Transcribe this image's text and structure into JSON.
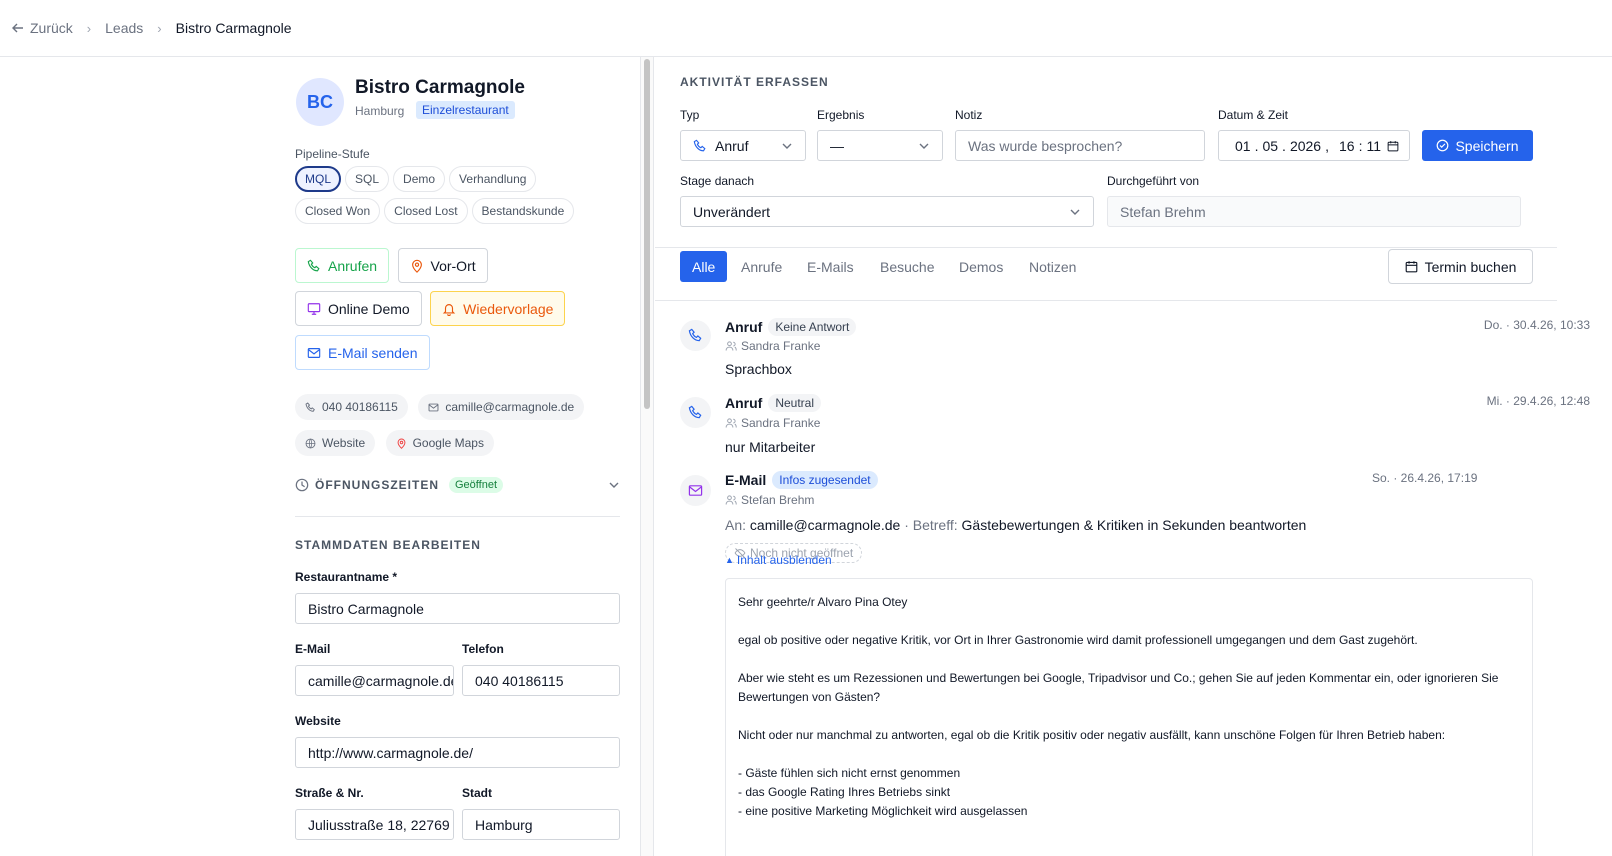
{
  "breadcrumb": {
    "back": "Zurück",
    "leads": "Leads",
    "current": "Bistro Carmagnole"
  },
  "lead": {
    "initials": "BC",
    "name": "Bistro Carmagnole",
    "city": "Hamburg",
    "type_badge": "Einzelrestaurant"
  },
  "pipeline": {
    "label": "Pipeline-Stufe",
    "stages": [
      "MQL",
      "SQL",
      "Demo",
      "Verhandlung",
      "Closed Won",
      "Closed Lost",
      "Bestandskunde"
    ],
    "active": "MQL"
  },
  "actions": {
    "call": "Anrufen",
    "onsite": "Vor-Ort",
    "demo": "Online Demo",
    "followup": "Wiedervorlage",
    "email": "E-Mail senden"
  },
  "contacts": {
    "phone": "040 40186115",
    "email": "camille@carmagnole.de",
    "website": "Website",
    "maps": "Google Maps"
  },
  "hours": {
    "title": "ÖFFNUNGSZEITEN",
    "status": "Geöffnet"
  },
  "master": {
    "title": "STAMMDATEN BEARBEITEN",
    "name_label": "Restaurantname *",
    "name_value": "Bistro Carmagnole",
    "email_label": "E-Mail",
    "email_value": "camille@carmagnole.de",
    "phone_label": "Telefon",
    "phone_value": "040 40186115",
    "website_label": "Website",
    "website_value": "http://www.carmagnole.de/",
    "street_label": "Straße & Nr.",
    "street_value": "Juliusstraße 18, 22769",
    "city_label": "Stadt",
    "city_value": "Hamburg"
  },
  "activity": {
    "title": "AKTIVITÄT ERFASSEN",
    "type_label": "Typ",
    "type_value": "Anruf",
    "result_label": "Ergebnis",
    "result_value": "—",
    "note_label": "Notiz",
    "note_placeholder": "Was wurde besprochen?",
    "datetime_label": "Datum & Zeit",
    "date_day": "01",
    "date_month": "05",
    "date_year": "2026",
    "time_hour": "16",
    "time_minute": "11",
    "save": "Speichern",
    "stage_label": "Stage danach",
    "stage_value": "Unverändert",
    "by_label": "Durchgeführt von",
    "by_value": "Stefan Brehm"
  },
  "tabs": [
    "Alle",
    "Anrufe",
    "E-Mails",
    "Besuche",
    "Demos",
    "Notizen"
  ],
  "book": "Termin buchen",
  "entries": [
    {
      "type": "Anruf",
      "badge": "Keine Antwort",
      "user": "Sandra Franke",
      "date": "Do. · 30.4.26, 10:33",
      "note": "Sprachbox"
    },
    {
      "type": "Anruf",
      "badge": "Neutral",
      "user": "Sandra Franke",
      "date": "Mi. · 29.4.26, 12:48",
      "note": "nur Mitarbeiter"
    },
    {
      "type": "E-Mail",
      "badge": "Infos zugesendet",
      "user": "Stefan Brehm",
      "date": "So. · 26.4.26, 17:19",
      "to_label": "An:",
      "to": "camille@carmagnole.de",
      "subject_label": "· Betreff:",
      "subject": "Gästebewertungen & Kritiken in Sekunden beantworten",
      "status": "Noch nicht geöffnet",
      "toggle": "Inhalt ausblenden",
      "body": {
        "greeting": "Sehr geehrte/r Alvaro Pina Otey",
        "p1": "egal ob positive oder negative Kritik, vor Ort in Ihrer Gastronomie wird damit professionell umgegangen und dem Gast zugehört.",
        "p2": "Aber wie steht es um Rezessionen und Bewertungen bei Google, Tripadvisor und Co.; gehen Sie auf jeden Kommentar ein, oder ignorieren Sie Bewertungen von Gästen?",
        "p3": "Nicht oder nur manchmal zu antworten, egal ob die Kritik positiv oder negativ ausfällt, kann unschöne Folgen für Ihren Betrieb haben:",
        "b1": "- Gäste fühlen sich nicht ernst genommen",
        "b2": "- das Google Rating Ihres Betriebs sinkt",
        "b3": "- eine positive Marketing Möglichkeit wird ausgelassen"
      }
    }
  ],
  "colors": {
    "primary": "#2563eb",
    "green": "#16a34a",
    "orange": "#ea580c",
    "purple": "#9333ea"
  }
}
